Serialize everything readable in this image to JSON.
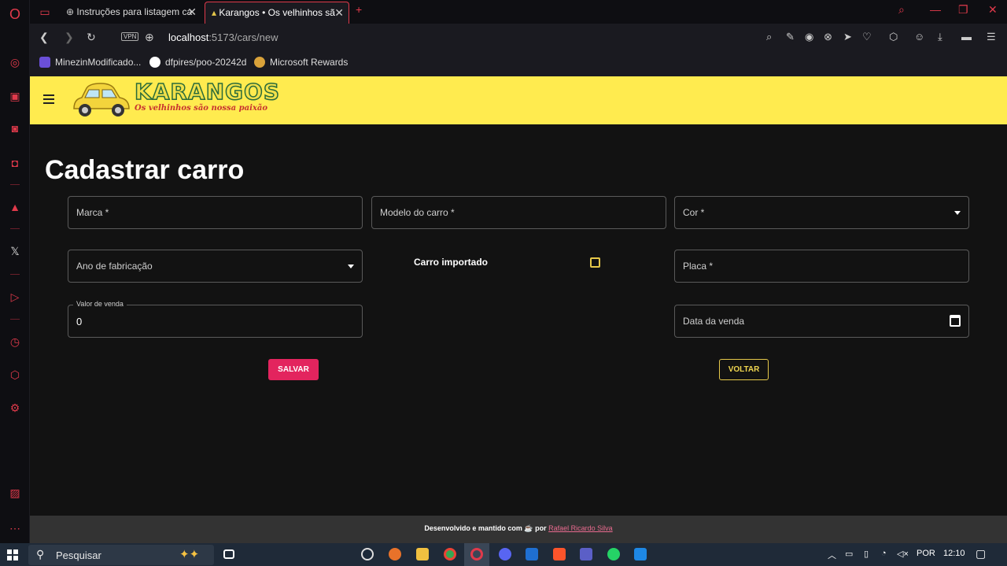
{
  "browser": {
    "tabs": [
      {
        "label": "Instruções para listagem ca"
      },
      {
        "label": "Karangos • Os velhinhos sã"
      }
    ],
    "vpn_label": "VPN",
    "url_host": "localhost",
    "url_rest": ":5173/cars/new",
    "bookmarks": [
      {
        "label": "MinezinModificado..."
      },
      {
        "label": "dfpires/poo-20242d"
      },
      {
        "label": "Microsoft Rewards"
      }
    ]
  },
  "app": {
    "logo_title": "KARANGOS",
    "logo_subtitle": "Os velhinhos são nossa paixão",
    "page_title": "Cadastrar carro",
    "form": {
      "brand_label": "Marca *",
      "model_label": "Modelo do carro *",
      "color_label": "Cor *",
      "year_label": "Ano de fabricação",
      "imported_label": "Carro importado",
      "plate_label": "Placa *",
      "price_label": "Valor de venda",
      "price_value": "0",
      "sale_date_label": "Data da venda"
    },
    "save_label": "SALVAR",
    "back_label": "VOLTAR",
    "footer_text": "Desenvolvido e mantido com",
    "footer_by": "por",
    "footer_author": "Rafael Ricardo Silva"
  },
  "taskbar": {
    "search_placeholder": "Pesquisar",
    "language": "POR",
    "time": "12:10"
  },
  "colors": {
    "appbar": "#ffeb4f",
    "save_button": "#e3245e",
    "back_button_border": "#e6c84a",
    "browser_accent": "#e03a4b"
  }
}
